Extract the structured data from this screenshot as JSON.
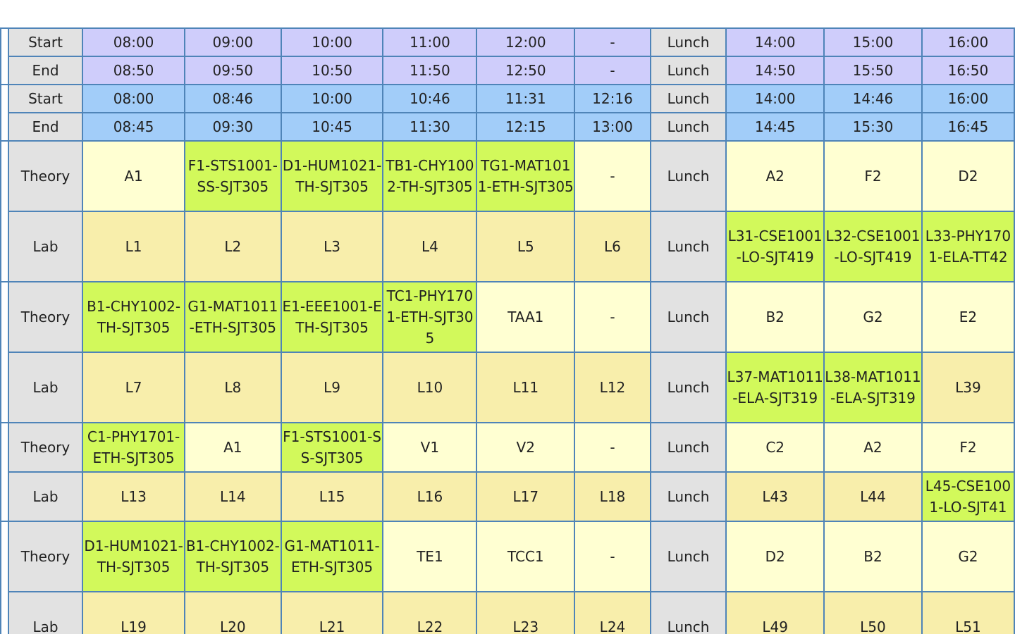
{
  "timing": {
    "theory": {
      "start": {
        "label": "Start",
        "cells": [
          "08:00",
          "09:00",
          "10:00",
          "11:00",
          "12:00",
          "-",
          "Lunch",
          "14:00",
          "15:00",
          "16:00"
        ]
      },
      "end": {
        "label": "End",
        "cells": [
          "08:50",
          "09:50",
          "10:50",
          "11:50",
          "12:50",
          "-",
          "Lunch",
          "14:50",
          "15:50",
          "16:50"
        ]
      }
    },
    "lab": {
      "start": {
        "label": "Start",
        "cells": [
          "08:00",
          "08:46",
          "10:00",
          "10:46",
          "11:31",
          "12:16",
          "Lunch",
          "14:00",
          "14:46",
          "16:00"
        ]
      },
      "end": {
        "label": "End",
        "cells": [
          "08:45",
          "09:30",
          "10:45",
          "11:30",
          "12:15",
          "13:00",
          "Lunch",
          "14:45",
          "15:30",
          "16:45"
        ]
      }
    }
  },
  "days": [
    {
      "theory": {
        "label": "Theory",
        "cells": [
          {
            "text": "A1",
            "busy": false
          },
          {
            "text": "F1-STS1001-SS-SJT305",
            "busy": true
          },
          {
            "text": "D1-HUM1021-TH-SJT305",
            "busy": true
          },
          {
            "text": "TB1-CHY1002-TH-SJT305",
            "busy": true
          },
          {
            "text": "TG1-MAT1011-ETH-SJT305",
            "busy": true
          },
          {
            "text": "-",
            "busy": false
          },
          {
            "text": "Lunch",
            "lunch": true
          },
          {
            "text": "A2",
            "busy": false
          },
          {
            "text": "F2",
            "busy": false
          },
          {
            "text": "D2",
            "busy": false
          }
        ]
      },
      "lab": {
        "label": "Lab",
        "cells": [
          {
            "text": "L1",
            "busy": false
          },
          {
            "text": "L2",
            "busy": false
          },
          {
            "text": "L3",
            "busy": false
          },
          {
            "text": "L4",
            "busy": false
          },
          {
            "text": "L5",
            "busy": false
          },
          {
            "text": "L6",
            "busy": false
          },
          {
            "text": "Lunch",
            "lunch": true
          },
          {
            "text": "L31-CSE1001-LO-SJT419",
            "busy": true
          },
          {
            "text": "L32-CSE1001-LO-SJT419",
            "busy": true
          },
          {
            "text": "L33-PHY1701-ELA-TT42",
            "busy": true
          }
        ]
      }
    },
    {
      "theory": {
        "label": "Theory",
        "cells": [
          {
            "text": "B1-CHY1002-TH-SJT305",
            "busy": true
          },
          {
            "text": "G1-MAT1011-ETH-SJT305",
            "busy": true
          },
          {
            "text": "E1-EEE1001-ETH-SJT305",
            "busy": true
          },
          {
            "text": "TC1-PHY1701-ETH-SJT305",
            "busy": true
          },
          {
            "text": "TAA1",
            "busy": false
          },
          {
            "text": "-",
            "busy": false
          },
          {
            "text": "Lunch",
            "lunch": true
          },
          {
            "text": "B2",
            "busy": false
          },
          {
            "text": "G2",
            "busy": false
          },
          {
            "text": "E2",
            "busy": false
          }
        ]
      },
      "lab": {
        "label": "Lab",
        "cells": [
          {
            "text": "L7",
            "busy": false
          },
          {
            "text": "L8",
            "busy": false
          },
          {
            "text": "L9",
            "busy": false
          },
          {
            "text": "L10",
            "busy": false
          },
          {
            "text": "L11",
            "busy": false
          },
          {
            "text": "L12",
            "busy": false
          },
          {
            "text": "Lunch",
            "lunch": true
          },
          {
            "text": "L37-MAT1011-ELA-SJT319",
            "busy": true
          },
          {
            "text": "L38-MAT1011-ELA-SJT319",
            "busy": true
          },
          {
            "text": "L39",
            "busy": false
          }
        ]
      }
    },
    {
      "theory": {
        "label": "Theory",
        "cells": [
          {
            "text": "C1-PHY1701-ETH-SJT305",
            "busy": true
          },
          {
            "text": "A1",
            "busy": false
          },
          {
            "text": "F1-STS1001-SS-SJT305",
            "busy": true
          },
          {
            "text": "V1",
            "busy": false
          },
          {
            "text": "V2",
            "busy": false
          },
          {
            "text": "-",
            "busy": false
          },
          {
            "text": "Lunch",
            "lunch": true
          },
          {
            "text": "C2",
            "busy": false
          },
          {
            "text": "A2",
            "busy": false
          },
          {
            "text": "F2",
            "busy": false
          }
        ]
      },
      "lab": {
        "label": "Lab",
        "cells": [
          {
            "text": "L13",
            "busy": false
          },
          {
            "text": "L14",
            "busy": false
          },
          {
            "text": "L15",
            "busy": false
          },
          {
            "text": "L16",
            "busy": false
          },
          {
            "text": "L17",
            "busy": false
          },
          {
            "text": "L18",
            "busy": false
          },
          {
            "text": "Lunch",
            "lunch": true
          },
          {
            "text": "L43",
            "busy": false
          },
          {
            "text": "L44",
            "busy": false
          },
          {
            "text": "L45-CSE1001-LO-SJT41",
            "busy": true
          }
        ]
      }
    },
    {
      "theory": {
        "label": "Theory",
        "cells": [
          {
            "text": "D1-HUM1021-TH-SJT305",
            "busy": true
          },
          {
            "text": "B1-CHY1002-TH-SJT305",
            "busy": true
          },
          {
            "text": "G1-MAT1011-ETH-SJT305",
            "busy": true
          },
          {
            "text": "TE1",
            "busy": false
          },
          {
            "text": "TCC1",
            "busy": false
          },
          {
            "text": "-",
            "busy": false
          },
          {
            "text": "Lunch",
            "lunch": true
          },
          {
            "text": "D2",
            "busy": false
          },
          {
            "text": "B2",
            "busy": false
          },
          {
            "text": "G2",
            "busy": false
          }
        ]
      },
      "lab": {
        "label": "Lab",
        "cells": [
          {
            "text": "L19",
            "busy": false
          },
          {
            "text": "L20",
            "busy": false
          },
          {
            "text": "L21",
            "busy": false
          },
          {
            "text": "L22",
            "busy": false
          },
          {
            "text": "L23",
            "busy": false
          },
          {
            "text": "L24",
            "busy": false
          },
          {
            "text": "Lunch",
            "lunch": true
          },
          {
            "text": "L49",
            "busy": false
          },
          {
            "text": "L50",
            "busy": false
          },
          {
            "text": "L51",
            "busy": false
          }
        ]
      }
    }
  ],
  "colors": {
    "border": "#4f84b8",
    "label_bg": "#e2e2e2",
    "theory_time_bg": "#cfcdfb",
    "lab_time_bg": "#a2cdf9",
    "free_theory_bg": "#ffffd2",
    "free_lab_bg": "#f8eeab",
    "busy_bg": "#d2f95b"
  }
}
